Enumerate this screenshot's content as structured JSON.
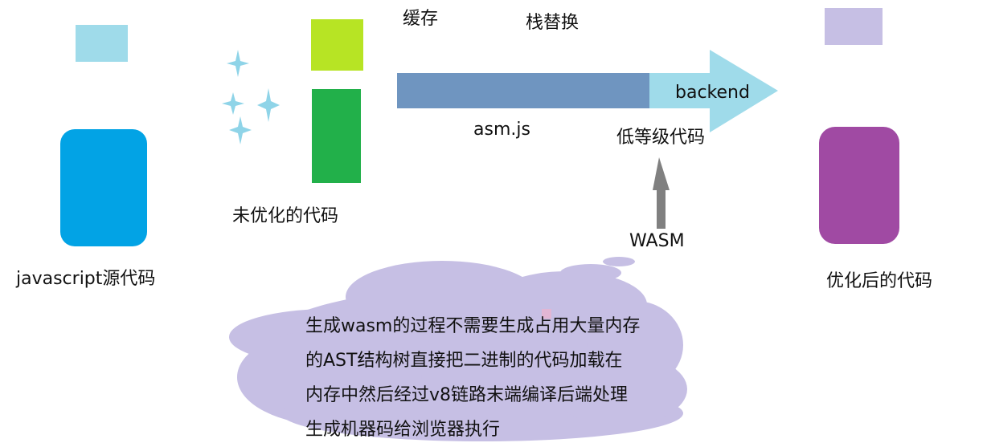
{
  "colors": {
    "js_source": "#02a3e5",
    "js_small": "#9fdbea",
    "sparkle": "#8fd4e8",
    "unopt_small": "#b7e424",
    "unopt_main": "#22b04a",
    "asm_bar": "#6f95c0",
    "arrow": "#9fdbea",
    "wasm_arrow": "#808080",
    "opt_small": "#c6bfe4",
    "opt_main": "#a04aa3",
    "cloud": "#c6bfe4"
  },
  "labels": {
    "js_source": "javascript源代码",
    "unoptimized": "未优化的代码",
    "cache": "缓存",
    "stack_replace": "栈替换",
    "backend": "backend",
    "asmjs": "asm.js",
    "low_level": "低等级代码",
    "wasm": "WASM",
    "optimized": "优化后的代码"
  },
  "cloud": {
    "lines": [
      "生成wasm的过程不需要生成占用大量内存",
      "的AST结构树直接把二进制的代码加载在",
      "内存中然后经过v8链路末端编译后端处理",
      "生成机器码给浏览器执行"
    ]
  },
  "icons": {
    "sparkles": "sparkle-icon",
    "wasm_arrow": "arrow-up-icon",
    "main_arrow": "arrow-right-icon"
  }
}
